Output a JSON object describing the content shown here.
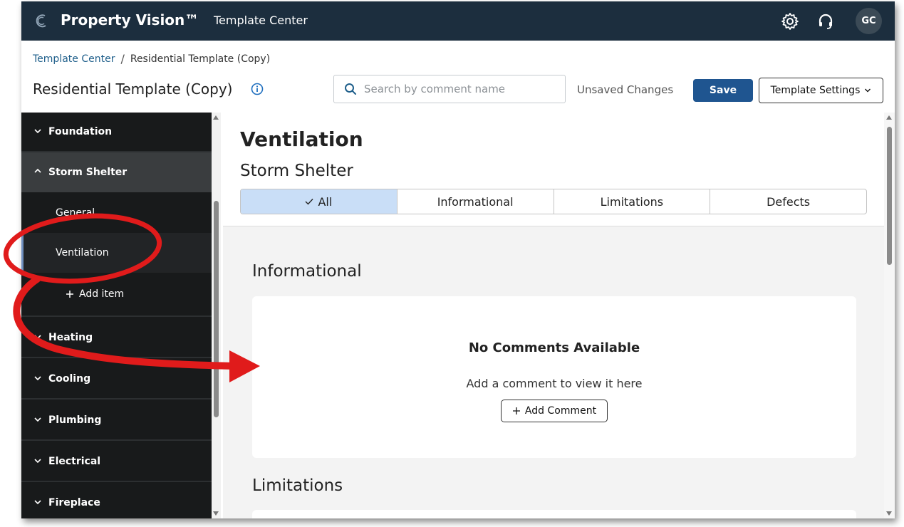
{
  "app": {
    "brand": "Property Vision™",
    "nav_label": "Template Center",
    "avatar_initials": "GC",
    "colors": {
      "topbar": "#1c2e3e",
      "accent": "#1f5590",
      "annotation": "#e01b1b"
    }
  },
  "breadcrumb": {
    "root": "Template Center",
    "separator": "/",
    "current": "Residential Template (Copy)"
  },
  "header": {
    "title": "Residential Template (Copy)",
    "search_placeholder": "Search by comment name",
    "unsaved_label": "Unsaved Changes",
    "save_label": "Save",
    "settings_label": "Template Settings"
  },
  "sidebar": {
    "sections": [
      {
        "label": "Foundation",
        "state": "collapsed"
      },
      {
        "label": "Storm Shelter",
        "state": "expanded"
      },
      {
        "label": "Heating",
        "state": "collapsed"
      },
      {
        "label": "Cooling",
        "state": "collapsed"
      },
      {
        "label": "Plumbing",
        "state": "collapsed"
      },
      {
        "label": "Electrical",
        "state": "collapsed"
      },
      {
        "label": "Fireplace",
        "state": "collapsed"
      }
    ],
    "subitems": [
      "General",
      "Ventilation"
    ],
    "add_item_label": "Add item"
  },
  "main": {
    "title": "Ventilation",
    "subtitle": "Storm Shelter",
    "tabs": [
      {
        "label": "All",
        "active": true
      },
      {
        "label": "Informational",
        "active": false
      },
      {
        "label": "Limitations",
        "active": false
      },
      {
        "label": "Defects",
        "active": false
      }
    ],
    "groups": [
      {
        "title": "Informational",
        "empty_title": "No Comments Available",
        "empty_text": "Add a comment to view it here",
        "add_label": "Add Comment"
      },
      {
        "title": "Limitations"
      }
    ]
  }
}
